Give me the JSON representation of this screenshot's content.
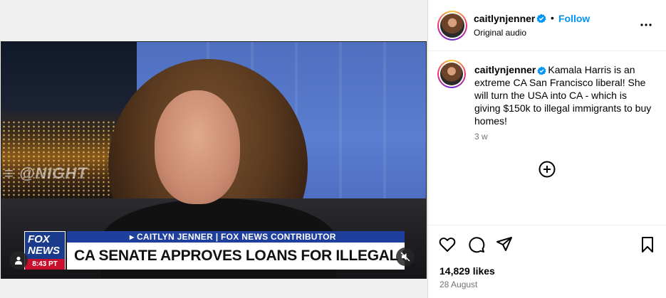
{
  "video": {
    "background_logo": "≡ @NIGHT",
    "fox_logo_top": "FOX",
    "fox_logo_bottom": "NEWS",
    "fox_time": "8:43 PT",
    "ticker": "▸ CAITLYN JENNER | FOX NEWS CONTRIBUTOR",
    "headline": "CA SENATE APPROVES LOANS FOR ILLEGAL MIGRANTS",
    "user_icon": "user-icon",
    "mute_icon": "muted-speaker-icon"
  },
  "header": {
    "username": "caitlynjenner",
    "verified_icon": "verified-badge-icon",
    "separator": "•",
    "follow_label": "Follow",
    "audio_label": "Original audio",
    "more_icon": "more-options-icon"
  },
  "caption": {
    "username": "caitlynjenner",
    "text": "Kamala Harris is an extreme CA San Francisco liberal! She will turn the USA into CA - which is giving $150k to illegal immigrants to buy homes!",
    "time_ago": "3 w",
    "add_icon": "add-comment-circle-icon"
  },
  "actions": {
    "like_icon": "heart-icon",
    "comment_icon": "comment-icon",
    "share_icon": "share-icon",
    "save_icon": "bookmark-icon",
    "likes": "14,829 likes",
    "date": "28 August"
  },
  "colors": {
    "follow": "#0095f6",
    "verified": "#0095f6",
    "muted_text": "#737373",
    "fox_blue": "#1e3f9e",
    "fox_red": "#c8102e"
  }
}
